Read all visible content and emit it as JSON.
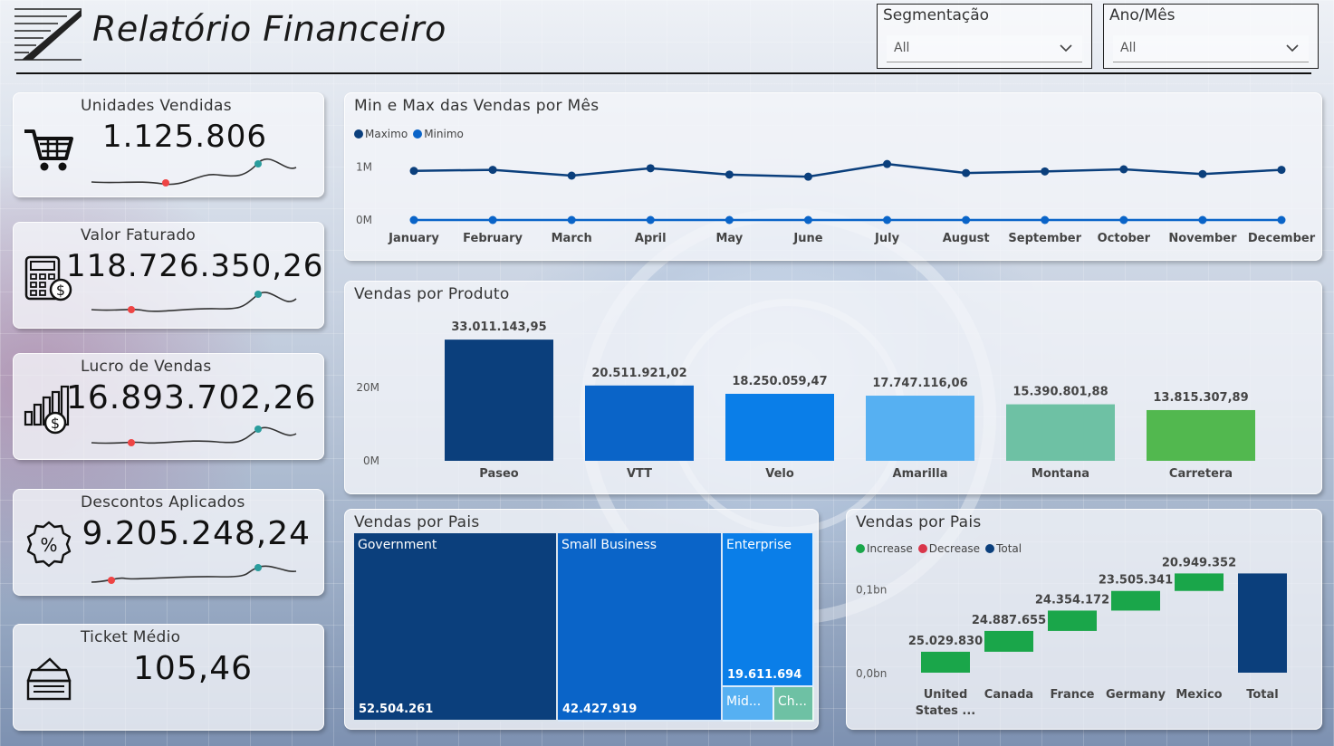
{
  "header": {
    "title": "Relatório Financeiro",
    "slicers": [
      {
        "label": "Segmentação",
        "value": "All"
      },
      {
        "label": "Ano/Mês",
        "value": "All"
      }
    ]
  },
  "kpis": [
    {
      "label": "Unidades Vendidas",
      "value": "1.125.806",
      "icon": "shopping-cart-icon"
    },
    {
      "label": "Valor Faturado",
      "value": "118.726.350,26",
      "icon": "calculator-dollar-icon"
    },
    {
      "label": "Lucro de Vendas",
      "value": "16.893.702,26",
      "icon": "bar-chart-dollar-icon"
    },
    {
      "label": "Descontos Aplicados",
      "value": "9.205.248,24",
      "icon": "discount-badge-icon"
    },
    {
      "label": "Ticket Médio",
      "value": "105,46",
      "icon": "cash-register-icon"
    }
  ],
  "colors": {
    "navy": "#0b3f7c",
    "blue": "#0a64c8",
    "azure": "#0a7ee8",
    "sky": "#56b0f2",
    "teal": "#6ec1a4",
    "green": "#52b84f",
    "increase": "#1aa64a",
    "decrease": "#d9364a",
    "total": "#0b3f7c",
    "spark_low": "#ee4444",
    "spark_high": "#2a9d9d"
  },
  "chart_data": [
    {
      "id": "minmax",
      "type": "line",
      "title": "Min e Max das Vendas por Mês",
      "categories": [
        "January",
        "February",
        "March",
        "April",
        "May",
        "June",
        "July",
        "August",
        "September",
        "October",
        "November",
        "December"
      ],
      "series": [
        {
          "name": "Maximo",
          "color": "#0b3f7c",
          "values": [
            0.93,
            0.95,
            0.84,
            0.98,
            0.86,
            0.82,
            1.06,
            0.89,
            0.92,
            0.96,
            0.87,
            0.95
          ]
        },
        {
          "name": "Minimo",
          "color": "#0a64c8",
          "values": [
            0,
            0,
            0,
            0,
            0,
            0,
            0,
            0,
            0,
            0,
            0,
            0
          ]
        }
      ],
      "y_unit": "M",
      "yticks": [
        {
          "value": 0,
          "label": "0M"
        },
        {
          "value": 1,
          "label": "1M"
        }
      ],
      "ylim": [
        0,
        1.2
      ],
      "legend": "top-left"
    },
    {
      "id": "produto",
      "type": "bar",
      "title": "Vendas por Produto",
      "categories": [
        "Paseo",
        "VTT",
        "Velo",
        "Amarilla",
        "Montana",
        "Carretera"
      ],
      "values": [
        33011143.95,
        20511921.02,
        18250059.47,
        17747116.06,
        15390801.88,
        13815307.89
      ],
      "data_labels": [
        "33.011.143,95",
        "20.511.921,02",
        "18.250.059,47",
        "17.747.116,06",
        "15.390.801,88",
        "13.815.307,89"
      ],
      "colors": [
        "#0b3f7c",
        "#0a64c8",
        "#0a7ee8",
        "#56b0f2",
        "#6ec1a4",
        "#52b84f"
      ],
      "yticks": [
        {
          "value": 0,
          "label": "0M"
        },
        {
          "value": 20000000,
          "label": "20M"
        }
      ],
      "ylim": [
        0,
        36000000
      ]
    },
    {
      "id": "treemap",
      "type": "treemap",
      "title": "Vendas por Pais",
      "items": [
        {
          "name": "Government",
          "value": 52504261,
          "label": "52.504.261",
          "color": "#0b3f7c"
        },
        {
          "name": "Small Business",
          "value": 42427919,
          "label": "42.427.919",
          "color": "#0a64c8"
        },
        {
          "name": "Enterprise",
          "value": 19611694,
          "label": "19.611.694",
          "color": "#0a7ee8"
        },
        {
          "name": "Mid...",
          "value": 2400000,
          "label": "",
          "color": "#56b0f2"
        },
        {
          "name": "Ch...",
          "value": 1800000,
          "label": "",
          "color": "#6ec1a4"
        }
      ]
    },
    {
      "id": "waterfall",
      "type": "waterfall",
      "title": "Vendas por Pais",
      "legend": [
        {
          "name": "Increase",
          "color": "#1aa64a"
        },
        {
          "name": "Decrease",
          "color": "#d9364a"
        },
        {
          "name": "Total",
          "color": "#0b3f7c"
        }
      ],
      "categories": [
        "United States ...",
        "Canada",
        "France",
        "Germany",
        "Mexico",
        "Total"
      ],
      "values": [
        25029830,
        24887655,
        24354172,
        23505341,
        20949352
      ],
      "data_labels": [
        "25.029.830",
        "24.887.655",
        "24.354.172",
        "23.505.341",
        "20.949.352"
      ],
      "yticks": [
        {
          "value": 0,
          "label": "0,0bn"
        },
        {
          "value": 100000000,
          "label": "0,1bn"
        }
      ],
      "ylim": [
        0,
        130000000
      ]
    }
  ]
}
